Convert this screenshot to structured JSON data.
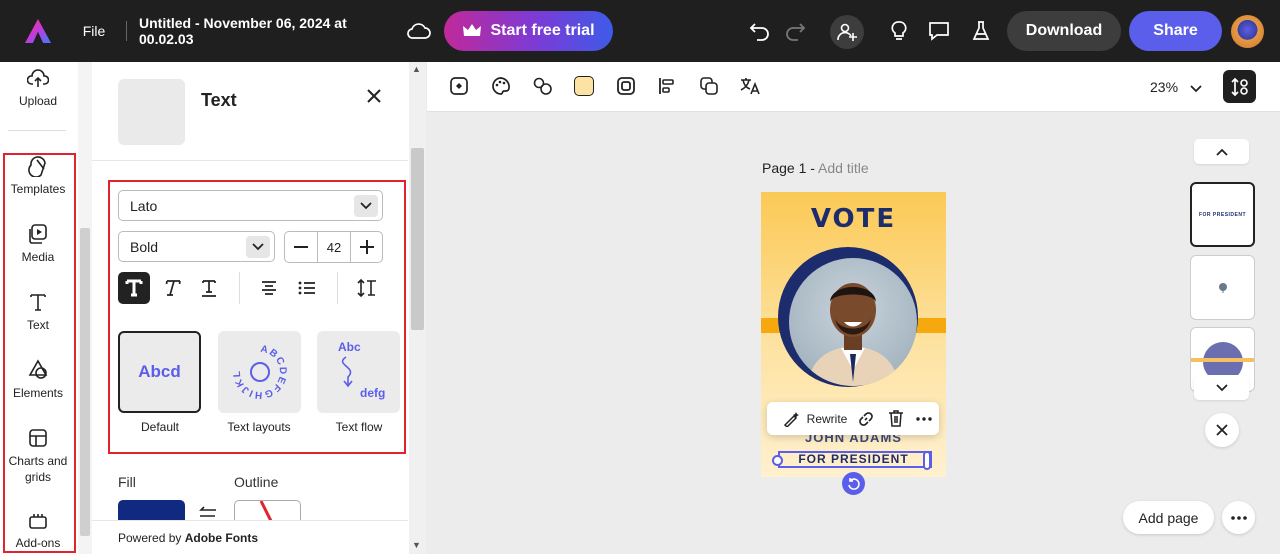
{
  "header": {
    "file_label": "File",
    "doc_title": "Untitled - November 06, 2024 at 00.02.03",
    "trial_label": "Start free trial",
    "download_label": "Download",
    "share_label": "Share"
  },
  "rail": {
    "upload": "Upload",
    "items": [
      {
        "label": "Templates",
        "icon": "templates-icon"
      },
      {
        "label": "Media",
        "icon": "media-icon"
      },
      {
        "label": "Text",
        "icon": "text-icon"
      },
      {
        "label": "Elements",
        "icon": "elements-icon"
      },
      {
        "label": "Charts and grids",
        "icon": "charts-grids-icon"
      },
      {
        "label": "Add-ons",
        "icon": "add-ons-icon"
      }
    ]
  },
  "panel": {
    "title": "Text",
    "font_family": "Lato",
    "font_weight": "Bold",
    "font_size": "42",
    "styles": [
      {
        "label": "Default",
        "preview": "Abcd"
      },
      {
        "label": "Text layouts",
        "preview": "ABCDEFGHIJKL"
      },
      {
        "label": "Text flow",
        "preview_top": "Abc",
        "preview_bottom": "defg"
      }
    ],
    "fill_label": "Fill",
    "outline_label": "Outline",
    "fill_color": "#0f2a80",
    "powered_prefix": "Powered by ",
    "powered_brand": "Adobe Fonts"
  },
  "canvas": {
    "zoom": "23%",
    "page_label": "Page 1 - ",
    "add_title": "Add title",
    "poster": {
      "headline": "VOTE",
      "name": "JOHN ADAMS",
      "tagline": "FOR PRESIDENT"
    },
    "context_menu": {
      "rewrite": "Rewrite"
    },
    "add_page": "Add page",
    "thumb1_text": "FOR PRESIDENT"
  },
  "colors": {
    "accent": "#5a5eea",
    "highlight_box": "#e0242d",
    "topbar": "#1f1f1f"
  }
}
